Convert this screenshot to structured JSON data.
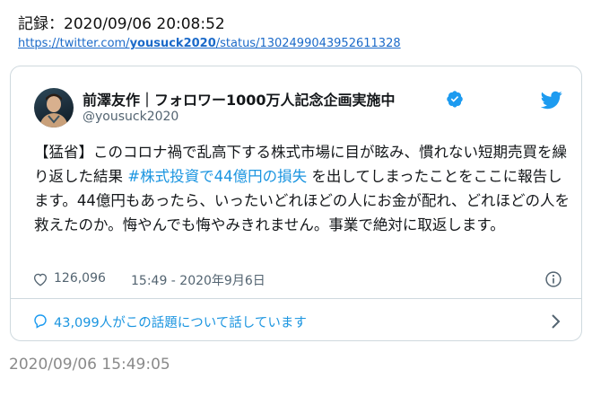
{
  "record": {
    "label": "記録：2020/09/06 20:08:52",
    "url_prefix": "https://twitter.com/",
    "url_user": "yousuck2020",
    "url_suffix": "/status/1302499043952611328"
  },
  "tweet": {
    "display_name": "前澤友作｜フォロワー1000万人記念企画実施中",
    "handle": "@yousuck2020",
    "text_before": "【猛省】このコロナ禍で乱高下する株式市場に目が眩み、慣れない短期売買を繰り返した結果 ",
    "hashtag": "#株式投資で44億円の損失",
    "text_after": " を出してしまったことをここに報告します。44億円もあったら、いったいどれほどの人にお金が配れ、どれほどの人を救えたのか。悔やんでも悔やみきれません。事業で絶対に取返します。",
    "likes": "126,096",
    "timestamp": "15:49 - 2020年9月6日",
    "conversation": "43,099人がこの話題について話しています"
  },
  "capture_time": "2020/09/06 15:49:05",
  "icons": {
    "verified": "verified-badge-icon",
    "bird": "twitter-bird-icon",
    "heart": "heart-icon",
    "info": "info-icon",
    "bubble": "speech-bubble-icon",
    "chevron": "chevron-right-icon"
  },
  "colors": {
    "link": "#1b6ac9",
    "twitter_blue": "#1d9bf0",
    "hashtag": "#1b95e0",
    "muted": "#536471",
    "border": "#cfd9de"
  }
}
